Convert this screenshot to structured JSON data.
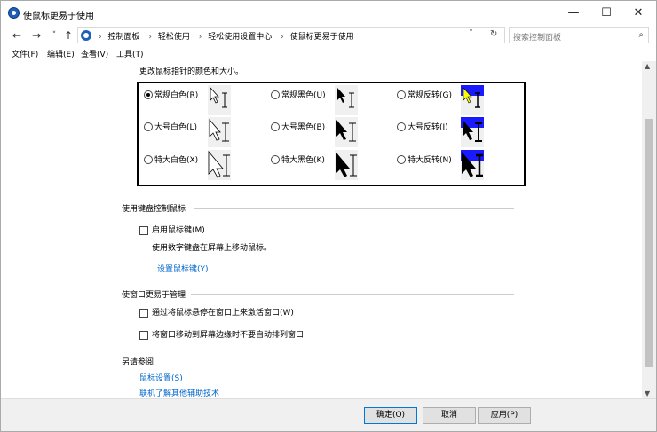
{
  "window": {
    "title": "使鼠标更易于使用",
    "controls": {
      "minimize": "—",
      "maximize": "☐",
      "close": "✕"
    }
  },
  "nav": {
    "back": "←",
    "forward": "→",
    "recent": "˅",
    "up": "↑",
    "breadcrumbs": [
      "控制面板",
      "轻松使用",
      "轻松使用设置中心",
      "使鼠标更易于使用"
    ],
    "separator": "›",
    "dropdown": "˅",
    "refresh": "↻"
  },
  "search": {
    "placeholder": "搜索控制面板",
    "icon": "⌕"
  },
  "menu": [
    "文件(F)",
    "编辑(E)",
    "查看(V)",
    "工具(T)"
  ],
  "intro": "更改鼠标指针的颜色和大小。",
  "schemes": [
    {
      "label": "常规白色(R)",
      "checked": true
    },
    {
      "label": "常规黑色(U)",
      "checked": false
    },
    {
      "label": "常规反转(G)",
      "checked": false
    },
    {
      "label": "大号白色(L)",
      "checked": false
    },
    {
      "label": "大号黑色(B)",
      "checked": false
    },
    {
      "label": "大号反转(I)",
      "checked": false
    },
    {
      "label": "特大白色(X)",
      "checked": false
    },
    {
      "label": "特大黑色(K)",
      "checked": false
    },
    {
      "label": "特大反转(N)",
      "checked": false
    }
  ],
  "keyboard_section": {
    "title": "使用键盘控制鼠标",
    "checkbox": "启用鼠标键(M)",
    "description": "使用数字键盘在屏幕上移动鼠标。",
    "link": "设置鼠标键(Y)"
  },
  "window_section": {
    "title": "使窗口更易于管理",
    "checkbox1": "通过将鼠标悬停在窗口上来激活窗口(W)",
    "checkbox2": "将窗口移动到屏幕边缘时不要自动排列窗口"
  },
  "see_also": {
    "title": "另请参阅",
    "link1": "鼠标设置(S)",
    "link2": "联机了解其他辅助技术"
  },
  "buttons": {
    "ok": "确定(O)",
    "cancel": "取消",
    "apply": "应用(P)"
  },
  "scroll": {
    "up": "▲",
    "down": "▼"
  },
  "colors": {
    "accent": "#0078d7",
    "link": "#0066cc",
    "invert_top": "#0000ff"
  }
}
